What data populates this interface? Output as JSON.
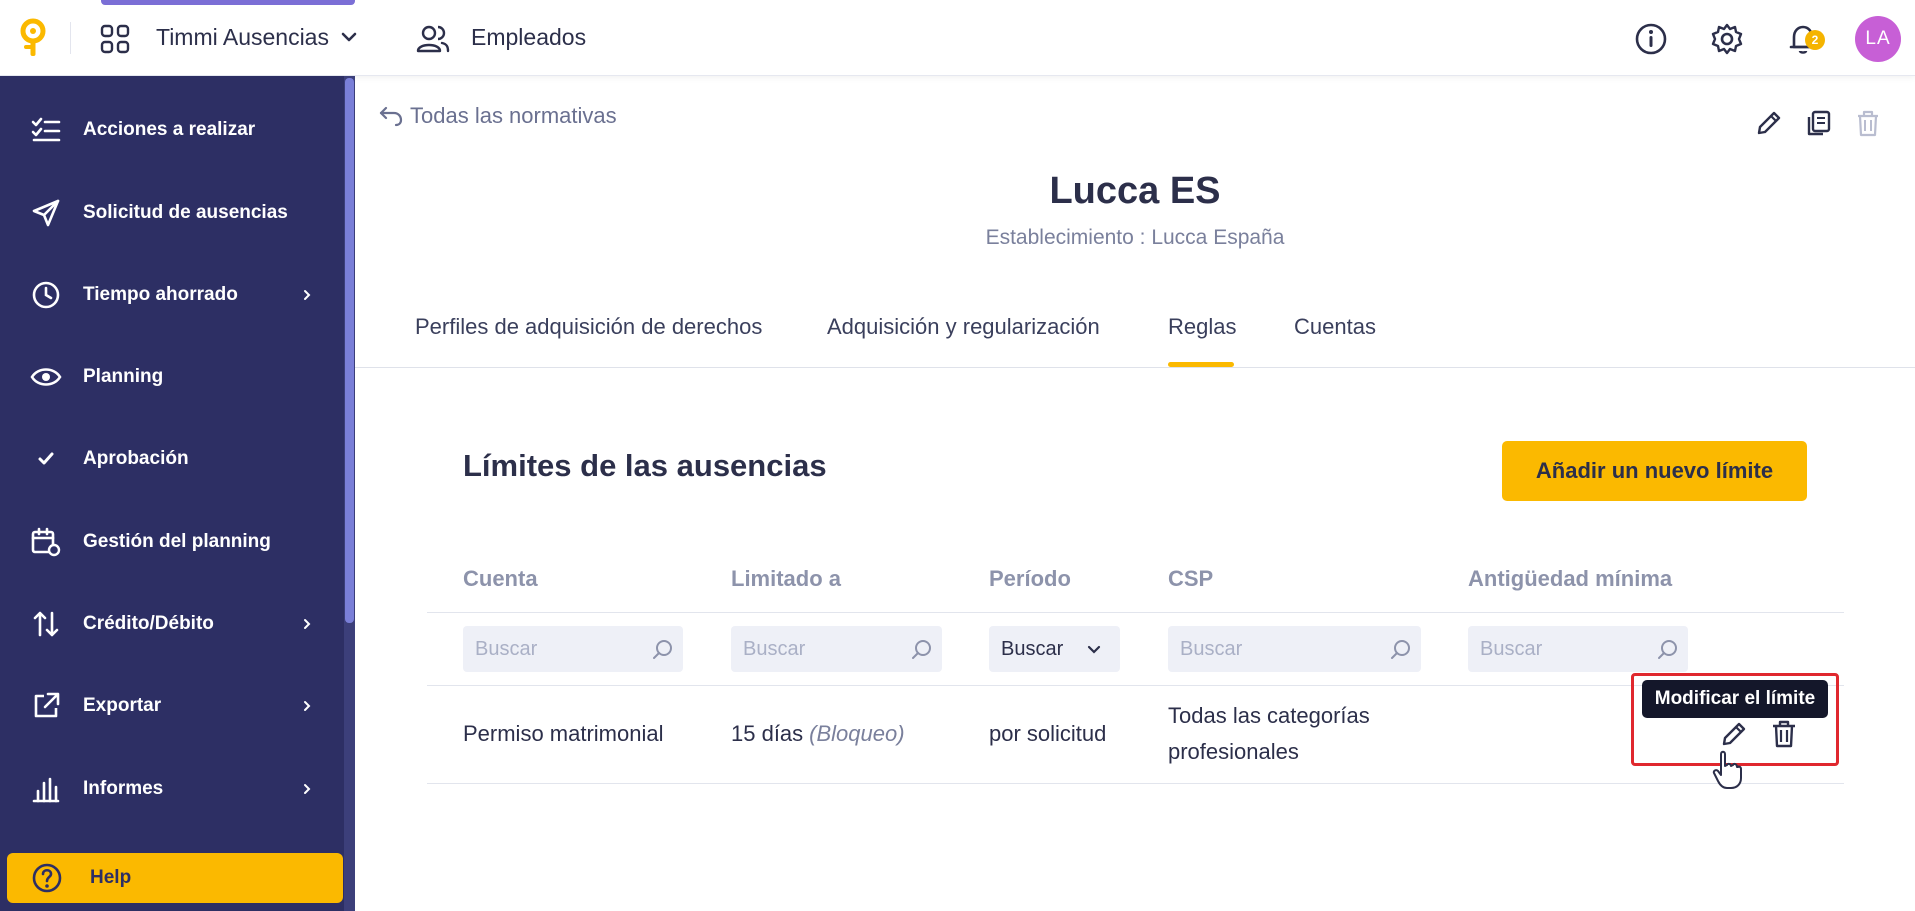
{
  "topbar": {
    "app_name": "Timmi Ausencias",
    "employees_label": "Empleados",
    "notification_count": "2",
    "avatar_initials": "LA",
    "icons": [
      "lucca-logo-icon",
      "apps-grid-icon",
      "chevron-down-icon",
      "users-icon",
      "info-icon",
      "gear-icon",
      "bell-icon"
    ]
  },
  "sidebar": {
    "items": [
      {
        "label": "Acciones a realizar",
        "icon": "checklist-icon",
        "has_arrow": false
      },
      {
        "label": "Solicitud de ausencias",
        "icon": "send-icon",
        "has_arrow": false
      },
      {
        "label": "Tiempo ahorrado",
        "icon": "clock-icon",
        "has_arrow": true
      },
      {
        "label": "Planning",
        "icon": "eye-icon",
        "has_arrow": false
      },
      {
        "label": "Aprobación",
        "icon": "check-icon",
        "has_arrow": false
      },
      {
        "label": "Gestión del planning",
        "icon": "calendar-gear-icon",
        "has_arrow": false
      },
      {
        "label": "Crédito/Débito",
        "icon": "sort-arrows-icon",
        "has_arrow": true
      },
      {
        "label": "Exportar",
        "icon": "external-link-icon",
        "has_arrow": true
      },
      {
        "label": "Informes",
        "icon": "bar-chart-icon",
        "has_arrow": true
      }
    ],
    "help_label": "Help"
  },
  "header": {
    "back_label": "Todas las normativas",
    "title": "Lucca ES",
    "subtitle": "Establecimiento : Lucca España",
    "actions": [
      "edit-icon",
      "duplicate-icon",
      "trash-icon"
    ]
  },
  "tabs": [
    {
      "label": "Perfiles de adquisición de derechos",
      "active": false
    },
    {
      "label": "Adquisición y regularización",
      "active": false
    },
    {
      "label": "Reglas",
      "active": true
    },
    {
      "label": "Cuentas",
      "active": false
    }
  ],
  "section": {
    "title": "Límites de las ausencias",
    "add_button": "Añadir un nuevo límite"
  },
  "table": {
    "columns": [
      "Cuenta",
      "Limitado a",
      "Período",
      "CSP",
      "Antigüedad mínima"
    ],
    "filters": {
      "cuenta_placeholder": "Buscar",
      "limitado_placeholder": "Buscar",
      "periodo_value": "Buscar",
      "csp_placeholder": "Buscar",
      "antiguedad_placeholder": "Buscar"
    },
    "rows": [
      {
        "cuenta": "Permiso matrimonial",
        "limitado": "15 días",
        "limitado_note": "(Bloqueo)",
        "periodo": "por solicitud",
        "csp_line1": "Todas las categorías",
        "csp_line2": "profesionales",
        "antiguedad": ""
      }
    ],
    "tooltip": "Modificar el límite"
  },
  "colors": {
    "sidebar_bg": "#2d2f64",
    "accent": "#fbb900",
    "highlight": "#e0282e",
    "avatar": "#c75fd6"
  }
}
